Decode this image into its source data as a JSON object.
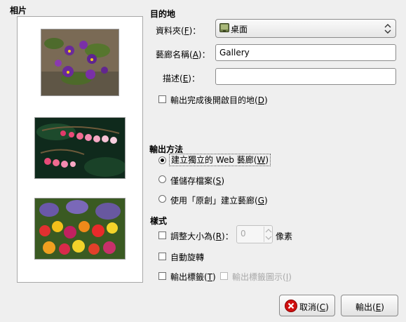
{
  "preview": {
    "title": "相片",
    "thumbnails": [
      {
        "name": "pansies"
      },
      {
        "name": "bleeding-hearts"
      },
      {
        "name": "primulas"
      }
    ]
  },
  "destination": {
    "title": "目的地",
    "folder_label": "資料夾(",
    "folder_key": "F",
    "folder_suffix": ")：",
    "folder_value": "桌面",
    "gallery_name_label": "藝廊名稱(",
    "gallery_name_key": "A",
    "gallery_name_suffix": ")：",
    "gallery_name_value": "Gallery",
    "description_label": "描述(",
    "description_key": "E",
    "description_suffix": ")：",
    "description_value": "",
    "open_after_label": "輸出完成後開啟目的地(",
    "open_after_key": "D",
    "open_after_suffix": ")",
    "open_after_checked": false
  },
  "output_method": {
    "title": "輸出方法",
    "options": [
      {
        "label": "建立獨立的 Web 藝廊(",
        "key": "W",
        "suffix": ")",
        "selected": true
      },
      {
        "label": "僅儲存檔案(",
        "key": "S",
        "suffix": ")",
        "selected": false
      },
      {
        "label": "使用「原創」建立藝廊(",
        "key": "G",
        "suffix": ")",
        "selected": false
      }
    ]
  },
  "style": {
    "title": "樣式",
    "resize_label": "調整大小為(",
    "resize_key": "R",
    "resize_suffix": ")：",
    "resize_value": "0",
    "resize_unit": "像素",
    "resize_checked": false,
    "auto_rotate_label": "自動旋轉",
    "auto_rotate_checked": false,
    "export_tags_label": "輸出標籤(",
    "export_tags_key": "T",
    "export_tags_suffix": ")",
    "export_tags_checked": false,
    "export_tag_icons_label": "輸出標籤圖示(",
    "export_tag_icons_key": "I",
    "export_tag_icons_suffix": ")",
    "export_tag_icons_checked": false
  },
  "buttons": {
    "cancel_label": "取消(",
    "cancel_key": "C",
    "cancel_suffix": ")",
    "export_label": "輸出(",
    "export_key": "E",
    "export_suffix": ")"
  },
  "colors": {
    "cancel_icon": "#d01010",
    "folder_icon": "#5a6e3a"
  }
}
